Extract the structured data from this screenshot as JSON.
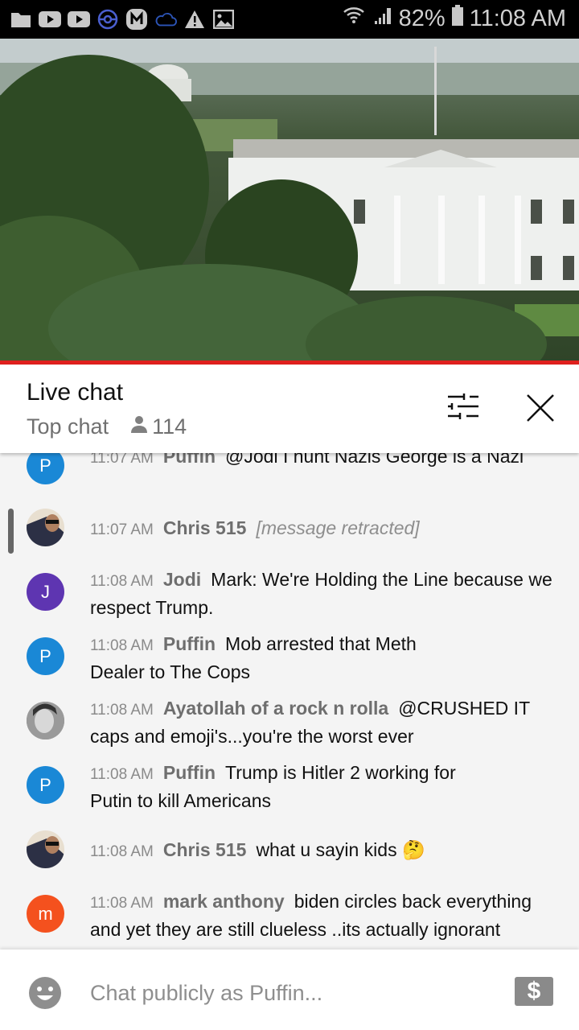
{
  "status_bar": {
    "left_icons": [
      "folder-icon",
      "youtube-icon",
      "youtube-icon",
      "pokeball-icon",
      "m-app-icon",
      "cloud-icon",
      "warning-icon",
      "image-icon"
    ],
    "battery": "82%",
    "time": "11:08 AM"
  },
  "video": {
    "description": "Live stream view of the White House"
  },
  "chat_header": {
    "title": "Live chat",
    "mode": "Top chat",
    "viewer_count": "114"
  },
  "messages": [
    {
      "avatar_letter": "P",
      "avatar_color": "#1a88d6",
      "time": "11:07 AM",
      "author": "Puffin",
      "text": "@Jodi I hunt Nazis George is a Nazi",
      "retracted": false
    },
    {
      "avatar_letter": "",
      "avatar_color": "#e8dfd0",
      "time": "11:07 AM",
      "author": "Chris 515",
      "text": "[message retracted]",
      "retracted": true
    },
    {
      "avatar_letter": "J",
      "avatar_color": "#5e35b1",
      "time": "11:08 AM",
      "author": "Jodi",
      "text": "Mark: We're Holding the Line because we respect Trump.",
      "retracted": false
    },
    {
      "avatar_letter": "P",
      "avatar_color": "#1a88d6",
      "time": "11:08 AM",
      "author": "Puffin",
      "text": "Mob arrested that Meth Dealer to The Cops",
      "retracted": false
    },
    {
      "avatar_letter": "",
      "avatar_color": "#777777",
      "time": "11:08 AM",
      "author": "Ayatollah of a rock n rolla",
      "text": "@CRUSHED IT caps and emoji's...you're the worst ever",
      "retracted": false
    },
    {
      "avatar_letter": "P",
      "avatar_color": "#1a88d6",
      "time": "11:08 AM",
      "author": "Puffin",
      "text": "Trump is Hitler 2 working for Putin to kill Americans",
      "retracted": false
    },
    {
      "avatar_letter": "",
      "avatar_color": "#e8dfd0",
      "time": "11:08 AM",
      "author": "Chris 515",
      "text": "what u sayin kids 🤔",
      "retracted": false
    },
    {
      "avatar_letter": "m",
      "avatar_color": "#f4511e",
      "time": "11:08 AM",
      "author": "mark anthony",
      "text": "biden circles back everything and yet they are still clueless ..its actually ignorant",
      "retracted": false
    }
  ],
  "input": {
    "placeholder": "Chat publicly as Puffin...",
    "value": "",
    "super_chat_symbol": "$"
  }
}
